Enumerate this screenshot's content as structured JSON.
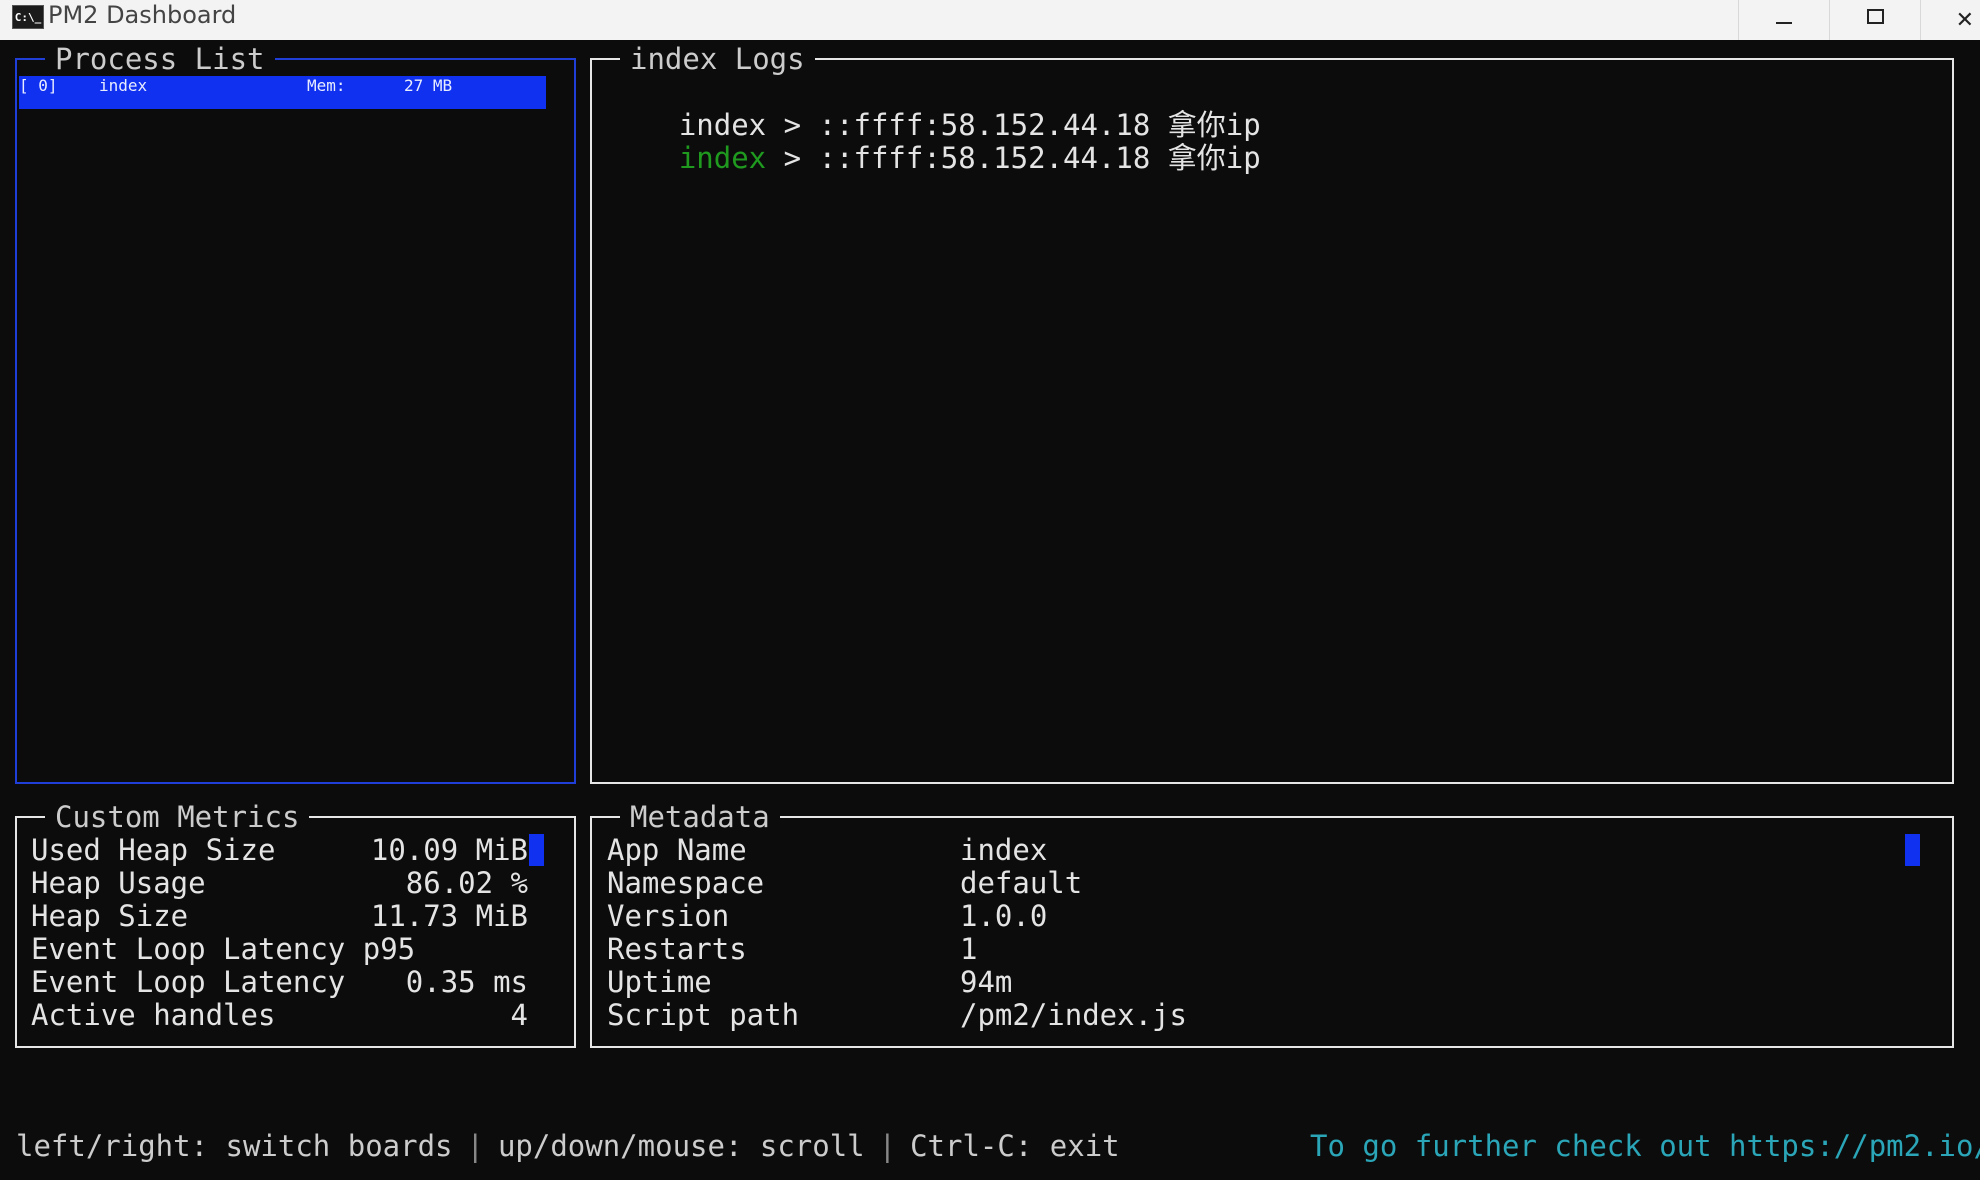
{
  "window": {
    "title": "PM2 Dashboard",
    "icon_text": "C:\\_",
    "icon": "terminal-icon"
  },
  "process_list": {
    "title": "Process List",
    "rows": [
      {
        "index": "[ 0]",
        "name": "index",
        "mem_label": "Mem:",
        "mem_value": "27 MB"
      }
    ]
  },
  "logs": {
    "title": "index Logs",
    "lines": [
      {
        "app": "index",
        "separator": ">",
        "message": "::ffff:58.152.44.18 拿你ip",
        "app_color": "#e4e4e4"
      },
      {
        "app": "index",
        "separator": ">",
        "message": "::ffff:58.152.44.18 拿你ip",
        "app_color": "#1f9a1f"
      }
    ]
  },
  "custom_metrics": {
    "title": "Custom Metrics",
    "rows": [
      {
        "label": "Used Heap Size",
        "value": "10.09 MiB"
      },
      {
        "label": "Heap Usage",
        "value": "86.02 %"
      },
      {
        "label": "Heap Size",
        "value": "11.73 MiB"
      },
      {
        "label": "Event Loop Latency p95",
        "value": ""
      },
      {
        "label": "Event Loop Latency",
        "value": "0.35 ms"
      },
      {
        "label": "Active handles",
        "value": "4"
      }
    ]
  },
  "metadata": {
    "title": "Metadata",
    "rows": [
      {
        "key": "App Name",
        "value": "index"
      },
      {
        "key": "Namespace",
        "value": "default"
      },
      {
        "key": "Version",
        "value": "1.0.0"
      },
      {
        "key": "Restarts",
        "value": "1"
      },
      {
        "key": "Uptime",
        "value": "94m"
      },
      {
        "key": "Script path",
        "value": "/pm2/index.js"
      }
    ]
  },
  "footer": {
    "switch_boards": "left/right: switch boards",
    "scroll": "up/down/mouse: scroll",
    "exit": "Ctrl-C: exit",
    "separator": "|",
    "link_text": "To go further check out https://pm2.io/"
  },
  "colors": {
    "background": "#0c0c0c",
    "focus_border": "#1f3fd8",
    "selection": "#1032f0",
    "link": "#2aa6b8",
    "log_green": "#1f9a1f"
  }
}
